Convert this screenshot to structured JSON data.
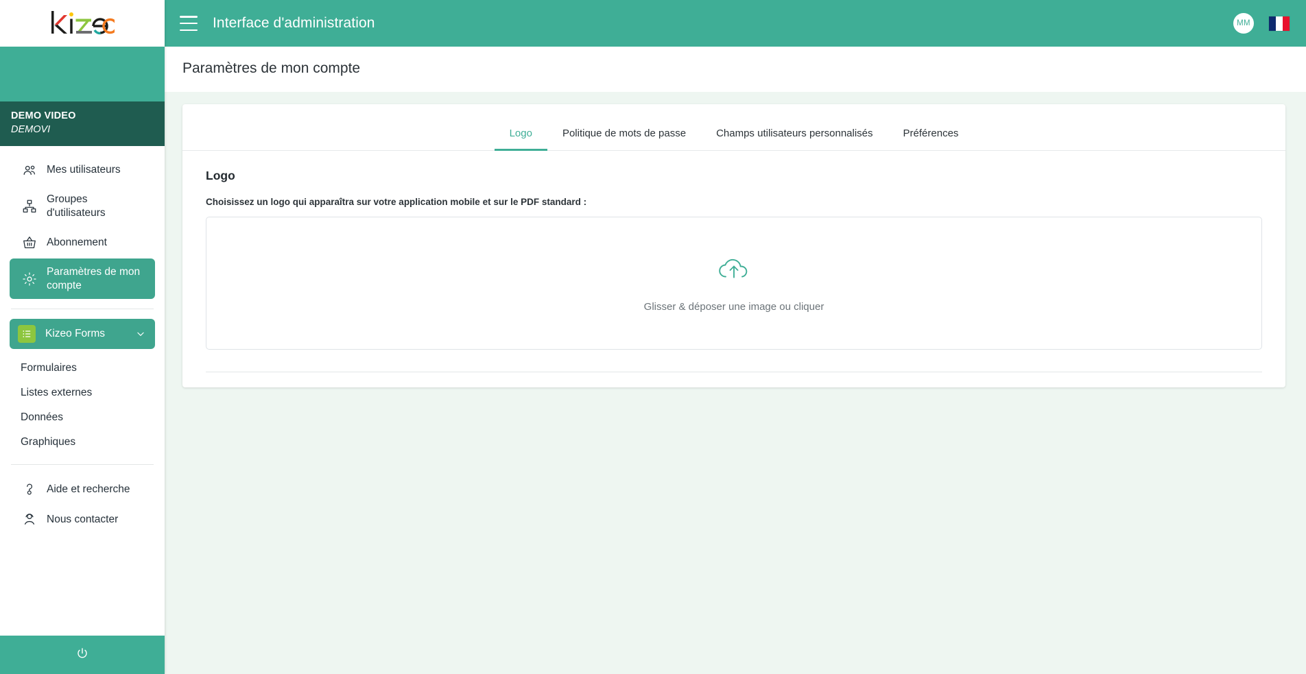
{
  "brand": {
    "logo_text": "kizeo",
    "colors": {
      "teal": "#3fae96",
      "teal_dark": "#1f5c50",
      "active_item": "#3fa58e",
      "forms_green": "#8dc63f",
      "content_bg": "#eef6f1"
    }
  },
  "sidebar": {
    "account": {
      "name": "DEMO VIDEO",
      "code": "DEMOVI"
    },
    "items": [
      {
        "label": "Mes utilisateurs",
        "icon": "users-icon",
        "active": false
      },
      {
        "label": "Groupes d'utilisateurs",
        "icon": "org-chart-icon",
        "active": false
      },
      {
        "label": "Abonnement",
        "icon": "basket-icon",
        "active": false
      },
      {
        "label": "Paramètres de mon compte",
        "icon": "gear-icon",
        "active": true
      }
    ],
    "section": {
      "label": "Kizeo Forms",
      "icon": "list-icon",
      "chevron": "chevron-down-icon",
      "sub_items": [
        {
          "label": "Formulaires"
        },
        {
          "label": "Listes externes"
        },
        {
          "label": "Données"
        },
        {
          "label": "Graphiques"
        }
      ]
    },
    "footer_links": [
      {
        "label": "Aide et recherche",
        "icon": "question-mark-icon"
      },
      {
        "label": "Nous contacter",
        "icon": "headset-icon"
      }
    ],
    "power": {
      "icon": "power-icon",
      "label": ""
    }
  },
  "topbar": {
    "menu_icon": "hamburger-menu-icon",
    "title": "Interface d'administration",
    "avatar_initials": "MM",
    "language_flag": "france-flag-icon"
  },
  "page": {
    "title": "Paramètres de mon compte"
  },
  "tabs": [
    {
      "label": "Logo",
      "active": true
    },
    {
      "label": "Politique de mots de passe",
      "active": false
    },
    {
      "label": "Champs utilisateurs personnalisés",
      "active": false
    },
    {
      "label": "Préférences",
      "active": false
    }
  ],
  "main": {
    "section_title": "Logo",
    "section_description": "Choisissez un logo qui apparaîtra sur votre application mobile et sur le PDF standard :",
    "dropzone": {
      "icon": "cloud-upload-icon",
      "text": "Glisser & déposer une image ou cliquer"
    }
  }
}
